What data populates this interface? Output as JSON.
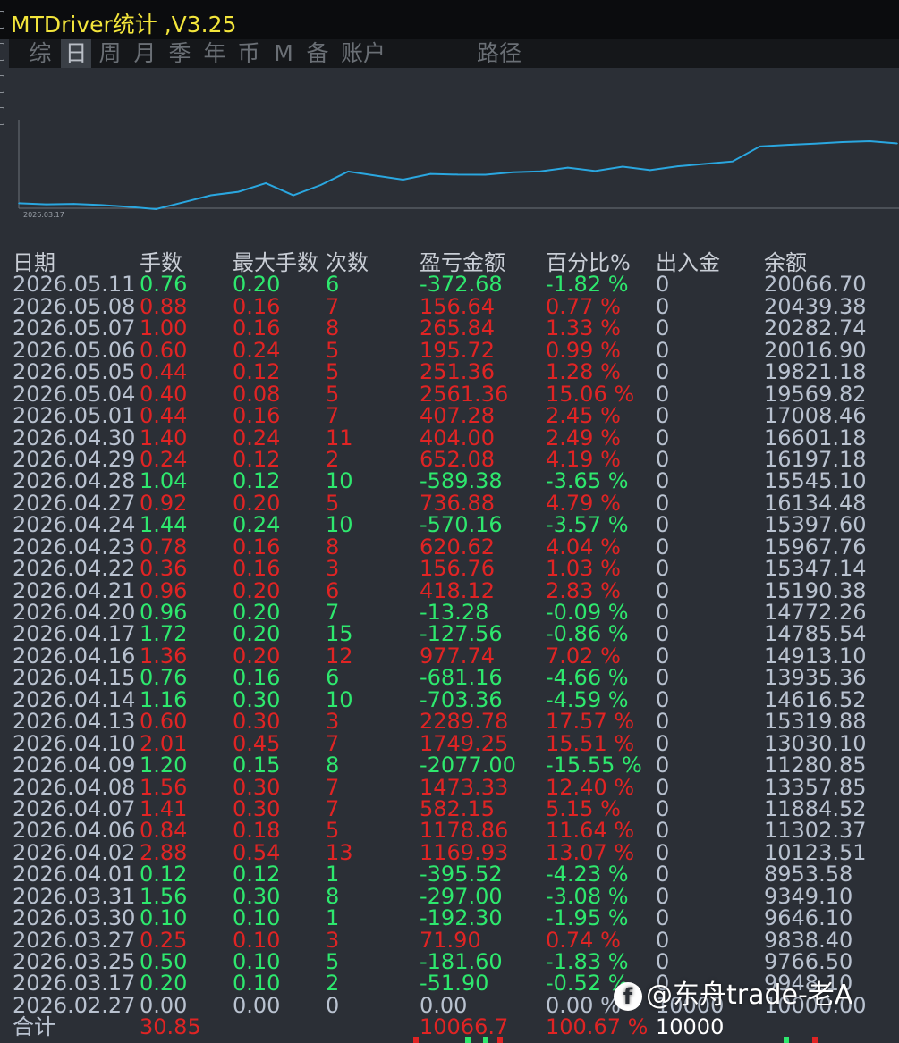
{
  "app": {
    "title": "MTDriver统计 ,V3.25"
  },
  "tabs": [
    {
      "label": "综"
    },
    {
      "label": "日"
    },
    {
      "label": "周"
    },
    {
      "label": "月"
    },
    {
      "label": "季"
    },
    {
      "label": "年"
    },
    {
      "label": "币"
    },
    {
      "label": "M"
    },
    {
      "label": "备"
    },
    {
      "label": "账户"
    },
    {
      "label": "路径"
    }
  ],
  "active_tab": "日",
  "chart": {
    "start_date_label": "2026.03.17",
    "line_color": "#2aa7e0"
  },
  "chart_data": {
    "type": "line",
    "title": "",
    "xlabel": "",
    "ylabel": "",
    "categories": [
      "2026.03.17",
      "2026.03.25",
      "2026.03.27",
      "2026.03.30",
      "2026.03.31",
      "2026.04.01",
      "2026.04.02",
      "2026.04.06",
      "2026.04.07",
      "2026.04.08",
      "2026.04.09",
      "2026.04.10",
      "2026.04.13",
      "2026.04.14",
      "2026.04.15",
      "2026.04.16",
      "2026.04.17",
      "2026.04.20",
      "2026.04.21",
      "2026.04.22",
      "2026.04.23",
      "2026.04.24",
      "2026.04.27",
      "2026.04.28",
      "2026.04.29",
      "2026.04.30",
      "2026.05.01",
      "2026.05.04",
      "2026.05.05",
      "2026.05.06",
      "2026.05.07",
      "2026.05.08",
      "2026.05.11"
    ],
    "series": [
      {
        "values": [
          9948.1,
          9766.5,
          9838.4,
          9646.1,
          9349.1,
          8953.58,
          10123.51,
          11302.37,
          11884.52,
          13357.85,
          11280.85,
          13030.1,
          15319.88,
          14616.52,
          13935.36,
          14913.1,
          14785.54,
          14772.26,
          15190.38,
          15347.14,
          15967.76,
          15397.6,
          16134.48,
          15545.1,
          16197.18,
          16601.18,
          17008.46,
          19569.82,
          19821.18,
          20016.9,
          20282.74,
          20439.38,
          20066.7
        ]
      }
    ],
    "grid": false
  },
  "table": {
    "headers": {
      "date": "日期",
      "lots": "手数",
      "max_lots": "最大手数",
      "count": "次数",
      "pnl": "盈亏金额",
      "pct": "百分比%",
      "deposit": "出入金",
      "balance": "余额"
    },
    "rows": [
      {
        "date": "2026.05.11",
        "lots": "0.76",
        "max_lots": "0.20",
        "count": "6",
        "pnl": "-372.68",
        "pct": "-1.82 %",
        "deposit": "0",
        "balance": "20066.70",
        "color": "green"
      },
      {
        "date": "2026.05.08",
        "lots": "0.88",
        "max_lots": "0.16",
        "count": "7",
        "pnl": "156.64",
        "pct": "0.77 %",
        "deposit": "0",
        "balance": "20439.38",
        "color": "red"
      },
      {
        "date": "2026.05.07",
        "lots": "1.00",
        "max_lots": "0.16",
        "count": "8",
        "pnl": "265.84",
        "pct": "1.33 %",
        "deposit": "0",
        "balance": "20282.74",
        "color": "red"
      },
      {
        "date": "2026.05.06",
        "lots": "0.60",
        "max_lots": "0.24",
        "count": "5",
        "pnl": "195.72",
        "pct": "0.99 %",
        "deposit": "0",
        "balance": "20016.90",
        "color": "red"
      },
      {
        "date": "2026.05.05",
        "lots": "0.44",
        "max_lots": "0.12",
        "count": "5",
        "pnl": "251.36",
        "pct": "1.28 %",
        "deposit": "0",
        "balance": "19821.18",
        "color": "red"
      },
      {
        "date": "2026.05.04",
        "lots": "0.40",
        "max_lots": "0.08",
        "count": "5",
        "pnl": "2561.36",
        "pct": "15.06 %",
        "deposit": "0",
        "balance": "19569.82",
        "color": "red"
      },
      {
        "date": "2026.05.01",
        "lots": "0.44",
        "max_lots": "0.16",
        "count": "7",
        "pnl": "407.28",
        "pct": "2.45 %",
        "deposit": "0",
        "balance": "17008.46",
        "color": "red"
      },
      {
        "date": "2026.04.30",
        "lots": "1.40",
        "max_lots": "0.24",
        "count": "11",
        "pnl": "404.00",
        "pct": "2.49 %",
        "deposit": "0",
        "balance": "16601.18",
        "color": "red"
      },
      {
        "date": "2026.04.29",
        "lots": "0.24",
        "max_lots": "0.12",
        "count": "2",
        "pnl": "652.08",
        "pct": "4.19 %",
        "deposit": "0",
        "balance": "16197.18",
        "color": "red"
      },
      {
        "date": "2026.04.28",
        "lots": "1.04",
        "max_lots": "0.12",
        "count": "10",
        "pnl": "-589.38",
        "pct": "-3.65 %",
        "deposit": "0",
        "balance": "15545.10",
        "color": "green"
      },
      {
        "date": "2026.04.27",
        "lots": "0.92",
        "max_lots": "0.20",
        "count": "5",
        "pnl": "736.88",
        "pct": "4.79 %",
        "deposit": "0",
        "balance": "16134.48",
        "color": "red"
      },
      {
        "date": "2026.04.24",
        "lots": "1.44",
        "max_lots": "0.24",
        "count": "10",
        "pnl": "-570.16",
        "pct": "-3.57 %",
        "deposit": "0",
        "balance": "15397.60",
        "color": "green"
      },
      {
        "date": "2026.04.23",
        "lots": "0.78",
        "max_lots": "0.16",
        "count": "8",
        "pnl": "620.62",
        "pct": "4.04 %",
        "deposit": "0",
        "balance": "15967.76",
        "color": "red"
      },
      {
        "date": "2026.04.22",
        "lots": "0.36",
        "max_lots": "0.16",
        "count": "3",
        "pnl": "156.76",
        "pct": "1.03 %",
        "deposit": "0",
        "balance": "15347.14",
        "color": "red"
      },
      {
        "date": "2026.04.21",
        "lots": "0.96",
        "max_lots": "0.20",
        "count": "6",
        "pnl": "418.12",
        "pct": "2.83 %",
        "deposit": "0",
        "balance": "15190.38",
        "color": "red"
      },
      {
        "date": "2026.04.20",
        "lots": "0.96",
        "max_lots": "0.20",
        "count": "7",
        "pnl": "-13.28",
        "pct": "-0.09 %",
        "deposit": "0",
        "balance": "14772.26",
        "color": "green"
      },
      {
        "date": "2026.04.17",
        "lots": "1.72",
        "max_lots": "0.20",
        "count": "15",
        "pnl": "-127.56",
        "pct": "-0.86 %",
        "deposit": "0",
        "balance": "14785.54",
        "color": "green"
      },
      {
        "date": "2026.04.16",
        "lots": "1.36",
        "max_lots": "0.20",
        "count": "12",
        "pnl": "977.74",
        "pct": "7.02 %",
        "deposit": "0",
        "balance": "14913.10",
        "color": "red"
      },
      {
        "date": "2026.04.15",
        "lots": "0.76",
        "max_lots": "0.16",
        "count": "6",
        "pnl": "-681.16",
        "pct": "-4.66 %",
        "deposit": "0",
        "balance": "13935.36",
        "color": "green"
      },
      {
        "date": "2026.04.14",
        "lots": "1.16",
        "max_lots": "0.30",
        "count": "10",
        "pnl": "-703.36",
        "pct": "-4.59 %",
        "deposit": "0",
        "balance": "14616.52",
        "color": "green"
      },
      {
        "date": "2026.04.13",
        "lots": "0.60",
        "max_lots": "0.30",
        "count": "3",
        "pnl": "2289.78",
        "pct": "17.57 %",
        "deposit": "0",
        "balance": "15319.88",
        "color": "red"
      },
      {
        "date": "2026.04.10",
        "lots": "2.01",
        "max_lots": "0.45",
        "count": "7",
        "pnl": "1749.25",
        "pct": "15.51 %",
        "deposit": "0",
        "balance": "13030.10",
        "color": "red"
      },
      {
        "date": "2026.04.09",
        "lots": "1.20",
        "max_lots": "0.15",
        "count": "8",
        "pnl": "-2077.00",
        "pct": "-15.55 %",
        "deposit": "0",
        "balance": "11280.85",
        "color": "green"
      },
      {
        "date": "2026.04.08",
        "lots": "1.56",
        "max_lots": "0.30",
        "count": "7",
        "pnl": "1473.33",
        "pct": "12.40 %",
        "deposit": "0",
        "balance": "13357.85",
        "color": "red"
      },
      {
        "date": "2026.04.07",
        "lots": "1.41",
        "max_lots": "0.30",
        "count": "7",
        "pnl": "582.15",
        "pct": "5.15 %",
        "deposit": "0",
        "balance": "11884.52",
        "color": "red"
      },
      {
        "date": "2026.04.06",
        "lots": "0.84",
        "max_lots": "0.18",
        "count": "5",
        "pnl": "1178.86",
        "pct": "11.64 %",
        "deposit": "0",
        "balance": "11302.37",
        "color": "red"
      },
      {
        "date": "2026.04.02",
        "lots": "2.88",
        "max_lots": "0.54",
        "count": "13",
        "pnl": "1169.93",
        "pct": "13.07 %",
        "deposit": "0",
        "balance": "10123.51",
        "color": "red"
      },
      {
        "date": "2026.04.01",
        "lots": "0.12",
        "max_lots": "0.12",
        "count": "1",
        "pnl": "-395.52",
        "pct": "-4.23 %",
        "deposit": "0",
        "balance": "8953.58",
        "color": "green"
      },
      {
        "date": "2026.03.31",
        "lots": "1.56",
        "max_lots": "0.30",
        "count": "8",
        "pnl": "-297.00",
        "pct": "-3.08 %",
        "deposit": "0",
        "balance": "9349.10",
        "color": "green"
      },
      {
        "date": "2026.03.30",
        "lots": "0.10",
        "max_lots": "0.10",
        "count": "1",
        "pnl": "-192.30",
        "pct": "-1.95 %",
        "deposit": "0",
        "balance": "9646.10",
        "color": "green"
      },
      {
        "date": "2026.03.27",
        "lots": "0.25",
        "max_lots": "0.10",
        "count": "3",
        "pnl": "71.90",
        "pct": "0.74 %",
        "deposit": "0",
        "balance": "9838.40",
        "color": "red"
      },
      {
        "date": "2026.03.25",
        "lots": "0.50",
        "max_lots": "0.10",
        "count": "5",
        "pnl": "-181.60",
        "pct": "-1.83 %",
        "deposit": "0",
        "balance": "9766.50",
        "color": "green"
      },
      {
        "date": "2026.03.17",
        "lots": "0.20",
        "max_lots": "0.10",
        "count": "2",
        "pnl": "-51.90",
        "pct": "-0.52 %",
        "deposit": "0",
        "balance": "9948.10",
        "color": "green"
      },
      {
        "date": "2026.02.27",
        "lots": "0.00",
        "max_lots": "0.00",
        "count": "0",
        "pnl": "0.00",
        "pct": "0.00 %",
        "deposit": "10000",
        "balance": "10000.00",
        "color": "white"
      }
    ],
    "total": {
      "label": "合计",
      "lots": "30.85",
      "pnl": "10066.7",
      "pct": "100.67 %",
      "deposit": "10000"
    }
  },
  "watermark": {
    "logo_char": "f",
    "text": "@东舟trade-老A"
  },
  "colors": {
    "profit": "#e02424",
    "loss": "#2ee86e",
    "neutral": "#b9c2d0",
    "title": "#f3e53b",
    "background": "#2b2f36"
  }
}
